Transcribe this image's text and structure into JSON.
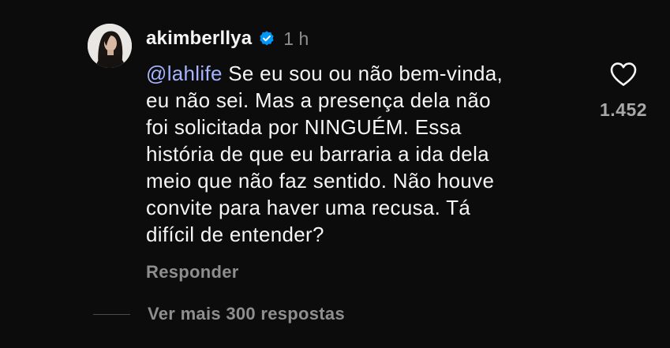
{
  "comment": {
    "username": "akimberllya",
    "verified_icon": "verified-badge-icon",
    "time": "1 h",
    "mention": "@lahlife",
    "lines": [
      " Se eu sou ou não bem-vinda,",
      "eu não sei. Mas a presença dela não",
      "foi solicitada por NINGUÉM. Essa",
      "história de que eu barraria a ida dela",
      "meio que não faz sentido. Não houve",
      "convite para haver uma recusa. Tá",
      "difícil de entender?"
    ],
    "reply_label": "Responder",
    "like_icon": "heart-outline-icon",
    "like_count": "1.452"
  },
  "replies": {
    "view_more_label": "Ver mais 300 respostas"
  },
  "colors": {
    "background": "#0c0c0c",
    "text": "#f5f5f5",
    "muted": "#8e8e8e",
    "mention": "#a5b4ff",
    "verified": "#0095f6"
  }
}
